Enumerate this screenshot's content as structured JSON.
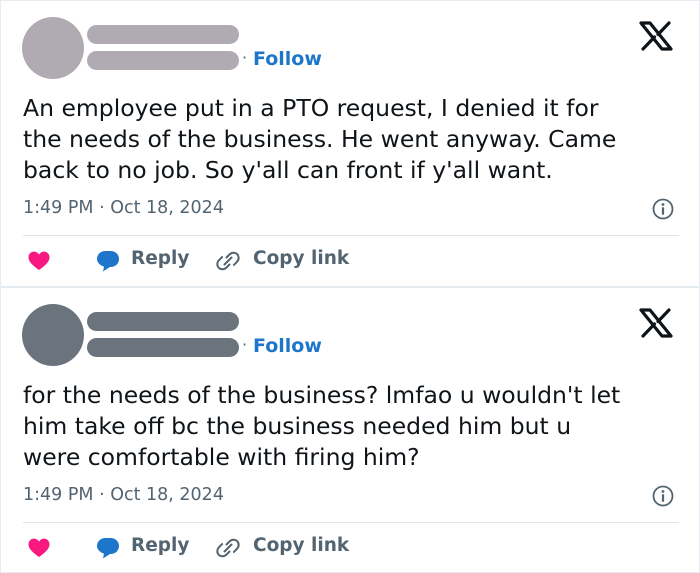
{
  "colors": {
    "avatar_1": "#b0abb3",
    "avatar_2": "#6b737c",
    "follow": "#1d76c9",
    "heart": "#f91880",
    "reply_bubble": "#1d76c9",
    "muted": "#536471"
  },
  "icons": {
    "logo": "x-logo-icon",
    "info": "info-circle-icon",
    "like": "heart-icon",
    "reply": "chat-bubble-icon",
    "copy": "link-chain-icon"
  },
  "tweets": [
    {
      "separator": "·",
      "follow_label": "Follow",
      "text": "An employee put in a PTO request, I denied it for\nthe needs of the business. He went anyway. Came\nback to no job. So y'all can front if y'all want.",
      "timestamp": "1:49 PM · Oct 18, 2024",
      "reply_label": "Reply",
      "copy_label": "Copy link"
    },
    {
      "separator": "·",
      "follow_label": "Follow",
      "text": "for the needs of the business? lmfao u wouldn't let\nhim take off bc the business needed him but u\nwere comfortable with firing him?",
      "timestamp": "1:49 PM · Oct 18, 2024",
      "reply_label": "Reply",
      "copy_label": "Copy link"
    }
  ]
}
